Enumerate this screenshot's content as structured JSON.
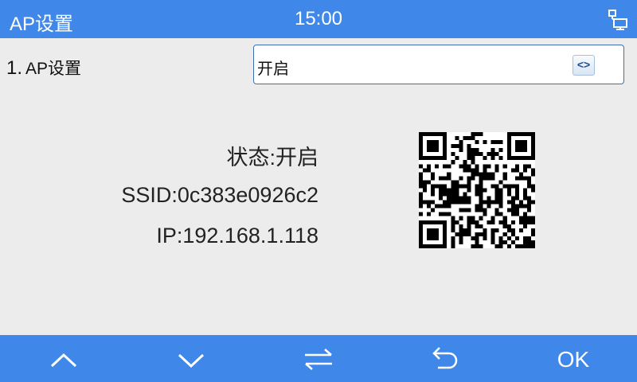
{
  "header": {
    "title": "AP设置",
    "time": "15:00",
    "network_icon": "network-icon"
  },
  "setting": {
    "number": "1.",
    "label": "AP设置",
    "value": "开启",
    "selector_icon": "left-right-arrows-icon"
  },
  "status": {
    "state": "状态:开启",
    "ssid": "SSID:0c383e0926c2",
    "ip": "IP:192.168.1.118"
  },
  "qr_icon": "qr-code-icon",
  "footer": {
    "up_icon": "chevron-up-icon",
    "down_icon": "chevron-down-icon",
    "switch_icon": "switch-arrows-icon",
    "back_icon": "back-arrow-icon",
    "ok_label": "OK"
  },
  "colors": {
    "bar": "#3f88ea",
    "background": "#ececec"
  }
}
